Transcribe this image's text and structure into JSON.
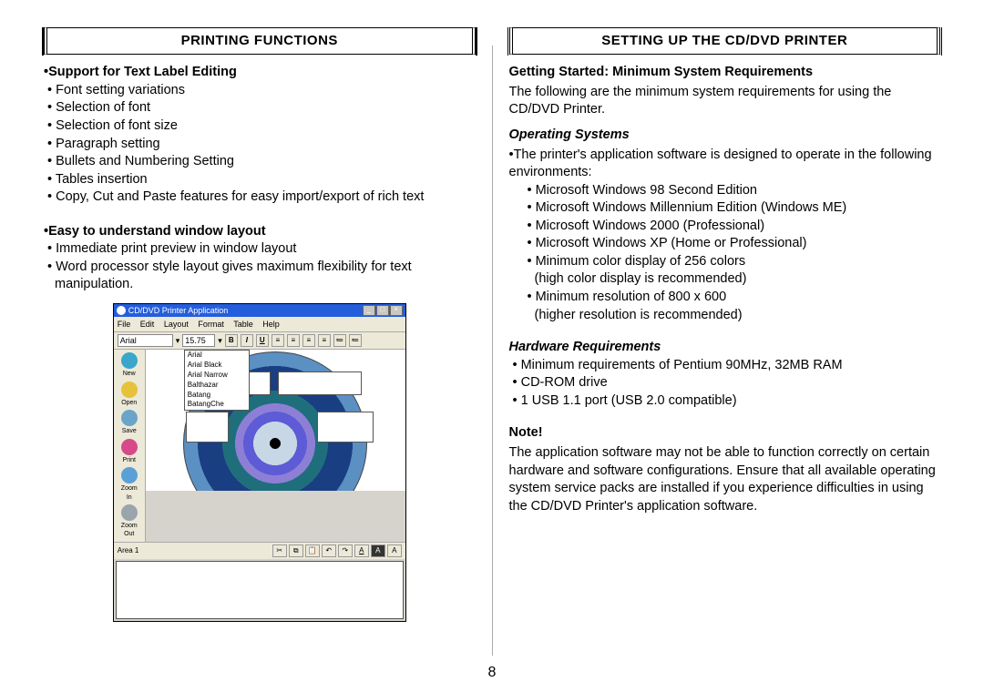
{
  "page_number": "8",
  "left": {
    "title": "PRINTING FUNCTIONS",
    "sec1_head": "•Support for Text Label Editing",
    "sec1_items": [
      "• Font setting variations",
      "• Selection of font",
      "• Selection of font size",
      "• Paragraph setting",
      "• Bullets and Numbering Setting",
      "• Tables insertion",
      "• Copy, Cut and Paste features for easy import/export of rich text"
    ],
    "sec2_head": "•Easy to understand window layout",
    "sec2_items": [
      "• Immediate print preview in window layout",
      "• Word processor style layout gives maximum flexibility for text manipulation."
    ],
    "app": {
      "title": "CD/DVD Printer Application",
      "menus": [
        "File",
        "Edit",
        "Layout",
        "Format",
        "Table",
        "Help"
      ],
      "font_name": "Arial",
      "font_size": "15.75",
      "bold": "B",
      "italic": "I",
      "underline": "U",
      "side": [
        {
          "label": "New",
          "color": "#3aa6c9"
        },
        {
          "label": "Open",
          "color": "#e6c23a"
        },
        {
          "label": "Save",
          "color": "#6aa5c9"
        },
        {
          "label": "Print",
          "color": "#d64a8a"
        },
        {
          "label": "Zoom In",
          "color": "#5aa0d6"
        },
        {
          "label": "Zoom Out",
          "color": "#9aa4ad"
        }
      ],
      "font_list": [
        "Arial",
        "Arial Black",
        "Arial Narrow",
        "Balthazar",
        "Batang",
        "BatangChe"
      ],
      "area_label": "Area 1",
      "bottom_A": "A"
    }
  },
  "right": {
    "title": "SETTING UP THE CD/DVD PRINTER",
    "gs_head": "Getting Started: Minimum System Requirements",
    "gs_para": "The following are the minimum system requirements for using the CD/DVD Printer.",
    "os_head": "Operating Systems",
    "os_intro": "•The printer's application software is designed to operate in the following environments:",
    "os_items": [
      "• Microsoft Windows 98 Second Edition",
      "• Microsoft Windows Millennium Edition (Windows ME)",
      "• Microsoft Windows 2000 (Professional)",
      "• Microsoft Windows XP (Home or Professional)",
      "• Minimum color display of 256 colors",
      "(high color display is recommended)",
      "• Minimum resolution of 800 x 600",
      "(higher resolution is recommended)"
    ],
    "hw_head": "Hardware Requirements",
    "hw_items": [
      "• Minimum requirements of Pentium 90MHz, 32MB RAM",
      "• CD-ROM drive",
      "• 1 USB 1.1 port (USB 2.0 compatible)"
    ],
    "note_head": "Note!",
    "note_para": "The application software may not be able to function correctly on certain hardware and software configurations. Ensure that all available operating system service packs are installed if you experience difficulties in using the CD/DVD Printer's application software."
  }
}
